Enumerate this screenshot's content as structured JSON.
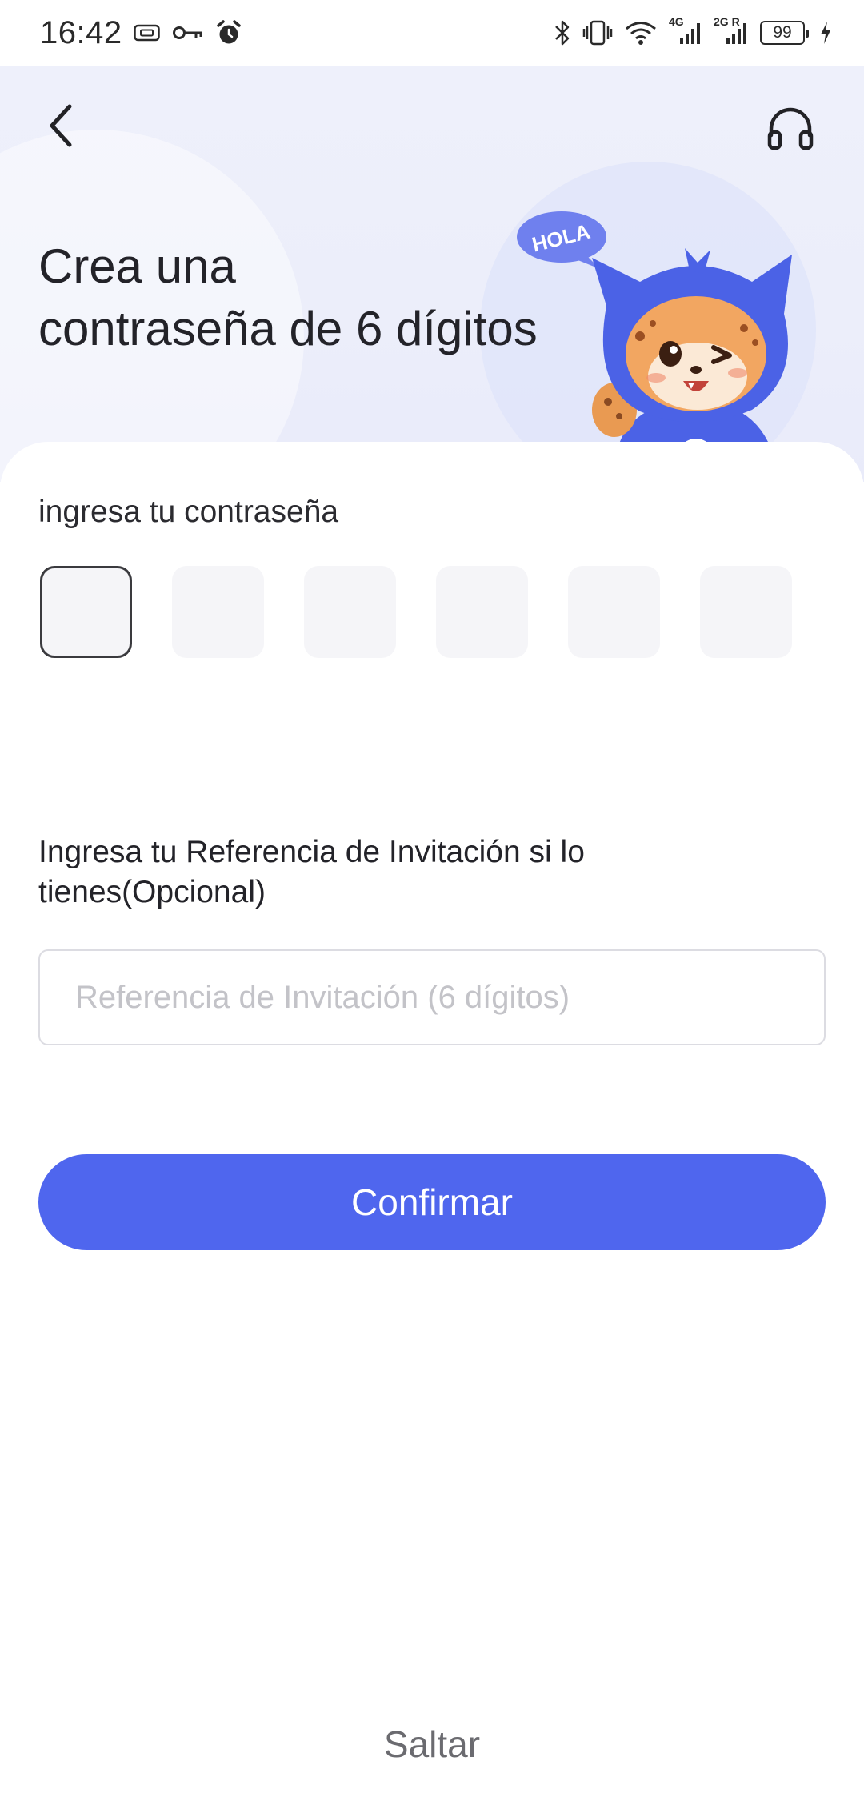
{
  "status_bar": {
    "time": "16:42",
    "battery": "99",
    "network_4g": "4G",
    "network_2g": "2G R",
    "icons": [
      "sim-card-icon",
      "key-icon",
      "alarm-icon",
      "bluetooth-icon",
      "vibrate-icon",
      "wifi-icon",
      "signal-4g-icon",
      "signal-2g-icon",
      "battery-icon",
      "charging-icon"
    ]
  },
  "header": {
    "title_line1": "Crea una",
    "title_line2": "contraseña de 6 dígitos",
    "mascot_bubble": "HOLA",
    "back_icon": "chevron-left-icon",
    "support_icon": "headphones-icon"
  },
  "form": {
    "password_label": "ingresa tu contraseña",
    "pin_length": 6,
    "invite_label": "Ingresa tu Referencia de Invitación si lo tienes(Opcional)",
    "invite_placeholder": "Referencia de Invitación (6 dígitos)",
    "invite_value": "",
    "confirm_label": "Confirmar",
    "skip_label": "Saltar"
  },
  "colors": {
    "accent": "#4f66ee",
    "hero_bg": "#eceefa",
    "pin_box_bg": "#f5f5f8"
  }
}
